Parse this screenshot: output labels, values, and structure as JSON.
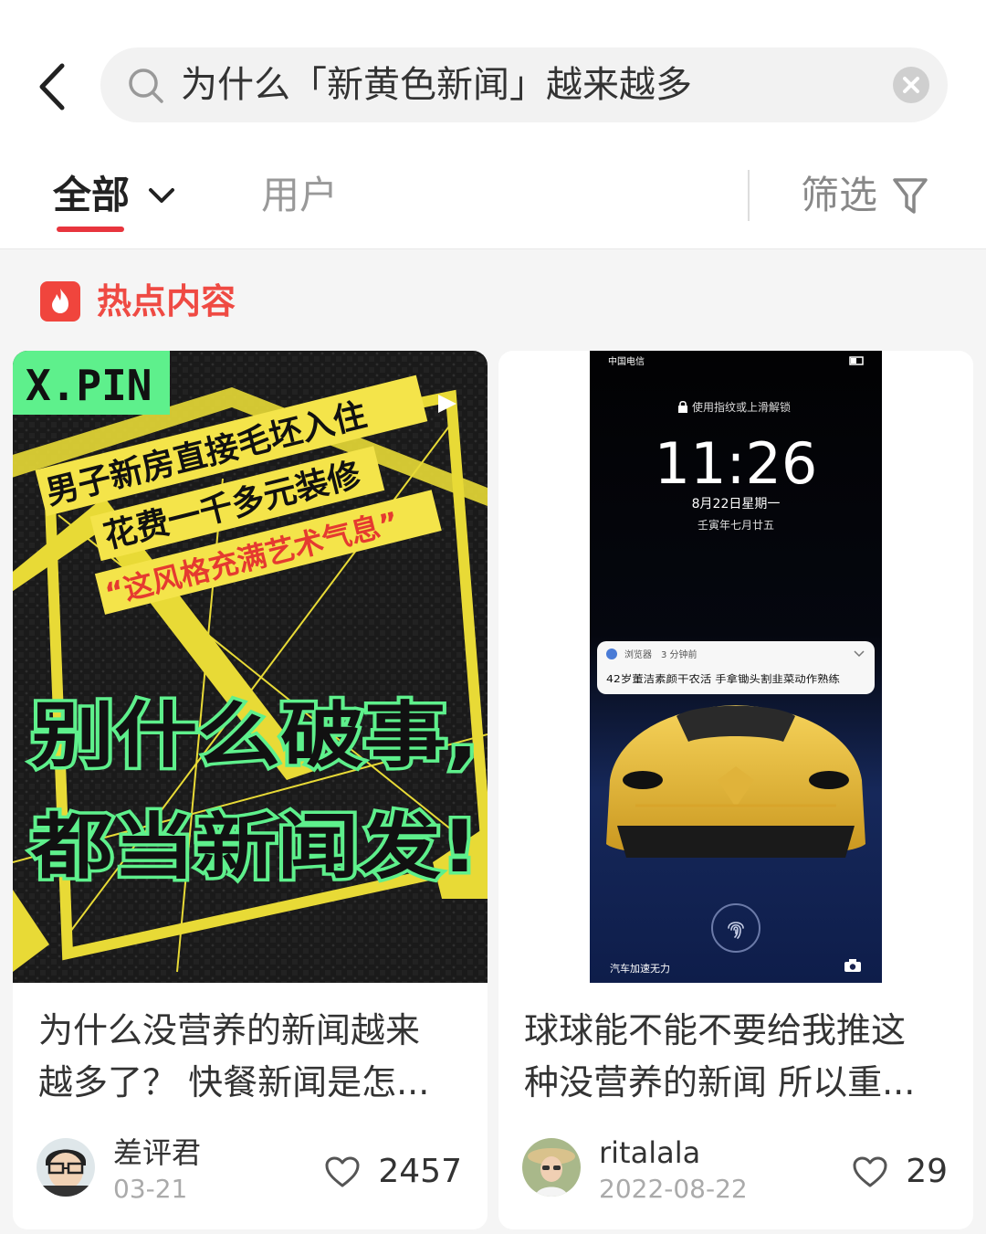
{
  "header": {
    "search_query": "为什么「新黄色新闻」越来越多"
  },
  "tabs": {
    "all_label": "全部",
    "user_label": "用户",
    "filter_label": "筛选"
  },
  "section": {
    "title": "热点内容"
  },
  "cards": [
    {
      "cover_text": {
        "logo": "X.PIN",
        "headline_1": "男子新房直接毛坯入住",
        "headline_2": "花费一千多元装修",
        "quote": "“这风格充满艺术气息”",
        "big_1": "别什么破事,",
        "big_2": "都当新闻发!"
      },
      "title_line1": "为什么没营养的新闻越来",
      "title_line2": "越多了？ 快餐新闻是怎...",
      "author": "差评君",
      "date": "03-21",
      "likes": "2457"
    },
    {
      "cover_text": {
        "status_carrier": "中国电信",
        "lock_hint": "使用指纹或上滑解锁",
        "time": "11:26",
        "date": "8月22日星期一",
        "lunar": "壬寅年七月廿五",
        "notif_app": "浏览器",
        "notif_time": "3 分钟前",
        "notif_text": "42岁董洁素颜干农活 手拿锄头割韭菜动作熟练",
        "caption": "汽车加速无力"
      },
      "title_line1": "球球能不能不要给我推这",
      "title_line2": "种没营养的新闻 所以重...",
      "author": "ritalala",
      "date": "2022-08-22",
      "likes": "29"
    }
  ],
  "colors": {
    "accent": "#e8353d",
    "hot_red": "#ef4a43",
    "neon_green": "#5ef08c",
    "yellow": "#f4e44a"
  }
}
